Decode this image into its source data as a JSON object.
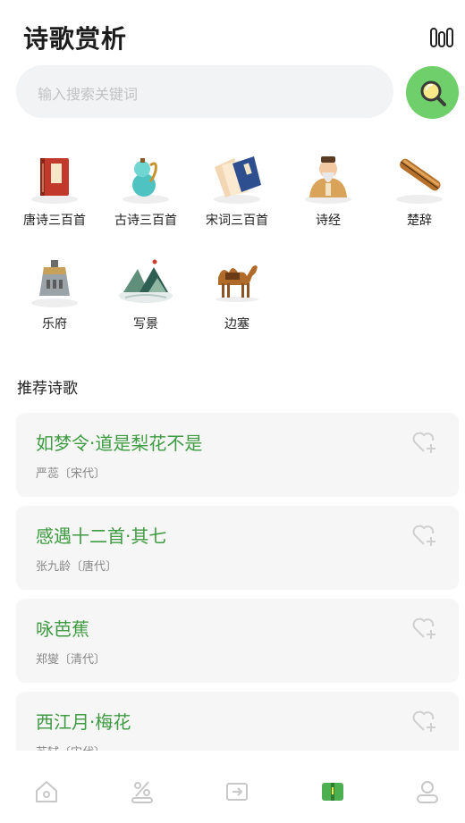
{
  "header": {
    "title": "诗歌赏析"
  },
  "search": {
    "placeholder": "输入搜索关键词"
  },
  "categories": [
    {
      "label": "唐诗三百首",
      "icon": "book-icon"
    },
    {
      "label": "古诗三百首",
      "icon": "gourd-icon"
    },
    {
      "label": "宋词三百首",
      "icon": "books-icon"
    },
    {
      "label": "诗经",
      "icon": "sage-icon"
    },
    {
      "label": "楚辞",
      "icon": "guqin-icon"
    },
    {
      "label": "乐府",
      "icon": "bell-icon"
    },
    {
      "label": "写景",
      "icon": "landscape-icon"
    },
    {
      "label": "边塞",
      "icon": "camel-icon"
    }
  ],
  "section": {
    "title": "推荐诗歌"
  },
  "poems": [
    {
      "title": "如梦令·道是梨花不是",
      "author": "严蕊〔宋代〕"
    },
    {
      "title": "感遇十二首·其七",
      "author": "张九龄〔唐代〕"
    },
    {
      "title": "咏芭蕉",
      "author": "郑燮〔清代〕"
    },
    {
      "title": "西江月·梅花",
      "author": "苏轼〔宋代〕"
    }
  ],
  "tabs": [
    {
      "icon": "home-icon"
    },
    {
      "icon": "percent-icon"
    },
    {
      "icon": "export-icon"
    },
    {
      "icon": "book-open-icon",
      "active": true
    },
    {
      "icon": "profile-icon"
    }
  ],
  "colors": {
    "accent": "#3e9b41",
    "search_button": "#6fcf6b",
    "tab_active": "#4caf50",
    "tab_inactive": "#c8c8c8"
  }
}
